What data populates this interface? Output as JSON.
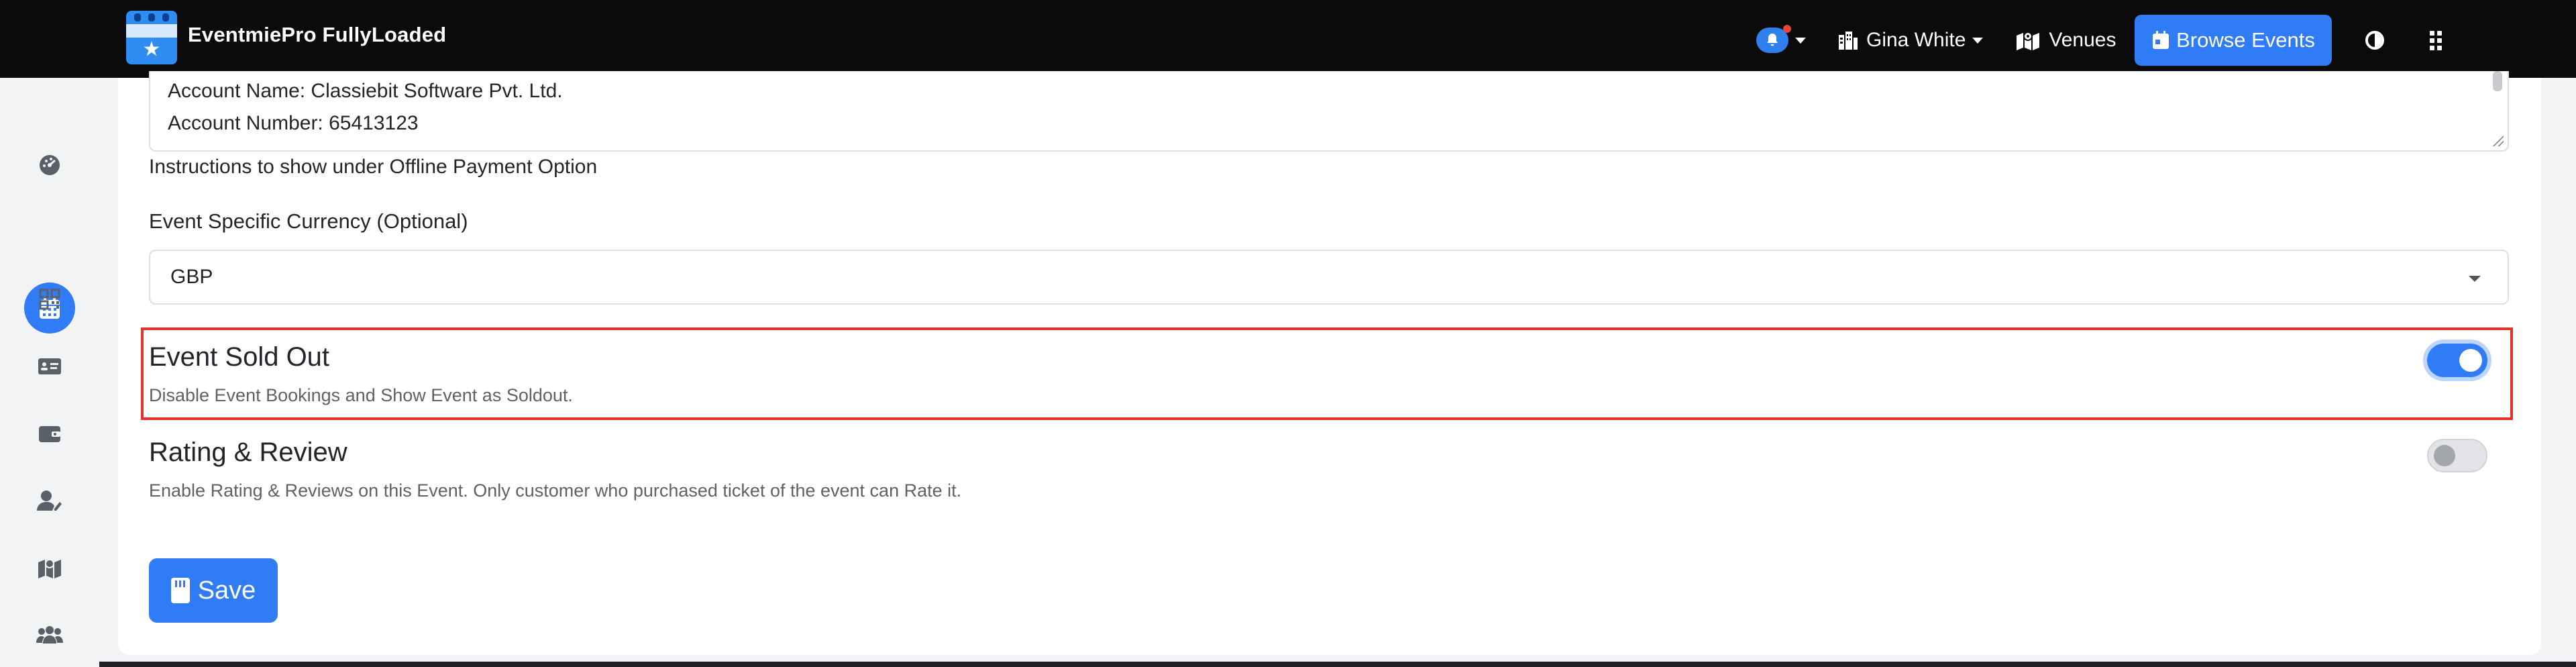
{
  "app": {
    "name": "EventmiePro FullyLoaded"
  },
  "header": {
    "user_name": "Gina White",
    "venues_label": "Venues",
    "browse_events_label": "Browse Events"
  },
  "sidebar": {
    "items": [
      {
        "icon": "dashboard-icon"
      },
      {
        "icon": "calendar-icon",
        "active": true
      },
      {
        "icon": "qrcode-icon"
      },
      {
        "icon": "ticket-icon"
      },
      {
        "icon": "wallet-icon"
      },
      {
        "icon": "user-edit-icon"
      },
      {
        "icon": "map-icon"
      },
      {
        "icon": "users-icon"
      }
    ]
  },
  "form": {
    "offline_payment": {
      "lines": [
        "Account Name: Classiebit Software Pvt. Ltd.",
        "Account Number: 65413123"
      ],
      "help": "Instructions to show under Offline Payment Option"
    },
    "currency": {
      "label": "Event Specific Currency (Optional)",
      "value": "GBP"
    },
    "sold_out": {
      "title": "Event Sold Out",
      "description": "Disable Event Bookings and Show Event as Soldout.",
      "enabled": true
    },
    "rating_review": {
      "title": "Rating & Review",
      "description": "Enable Rating & Reviews on this Event. Only customer who purchased ticket of the event can Rate it.",
      "enabled": false
    },
    "save_label": "Save"
  },
  "colors": {
    "primary": "#2f7cf6",
    "navbar": "#0b0b0c",
    "highlight": "#e4332b",
    "notification": "#e8443a"
  }
}
